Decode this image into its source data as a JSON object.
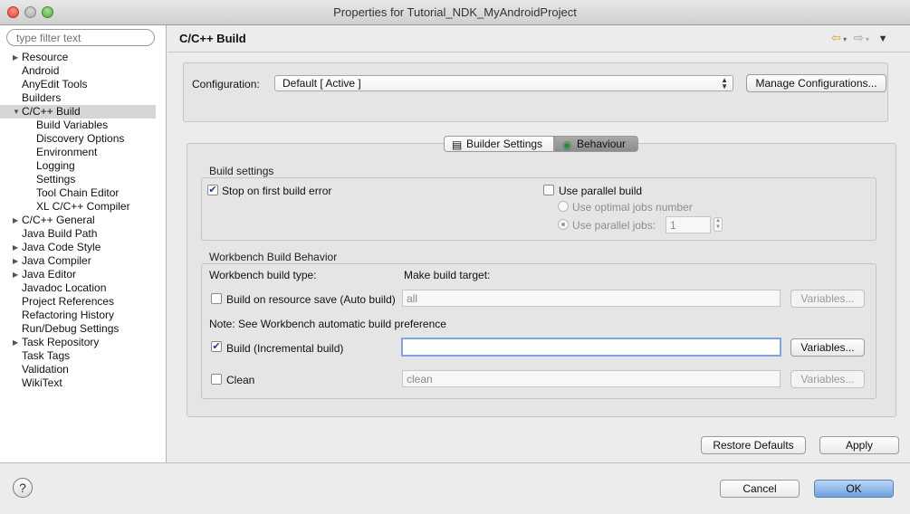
{
  "window": {
    "title": "Properties for Tutorial_NDK_MyAndroidProject"
  },
  "sidebar": {
    "filter_placeholder": "type filter text",
    "items": [
      {
        "label": "Resource",
        "expander": "right"
      },
      {
        "label": "Android"
      },
      {
        "label": "AnyEdit Tools"
      },
      {
        "label": "Builders"
      },
      {
        "label": "C/C++ Build",
        "expander": "down",
        "selected": true
      },
      {
        "label": "Build Variables",
        "child": true
      },
      {
        "label": "Discovery Options",
        "child": true
      },
      {
        "label": "Environment",
        "child": true
      },
      {
        "label": "Logging",
        "child": true
      },
      {
        "label": "Settings",
        "child": true
      },
      {
        "label": "Tool Chain Editor",
        "child": true
      },
      {
        "label": "XL C/C++ Compiler",
        "child": true
      },
      {
        "label": "C/C++ General",
        "expander": "right"
      },
      {
        "label": "Java Build Path"
      },
      {
        "label": "Java Code Style",
        "expander": "right"
      },
      {
        "label": "Java Compiler",
        "expander": "right"
      },
      {
        "label": "Java Editor",
        "expander": "right"
      },
      {
        "label": "Javadoc Location"
      },
      {
        "label": "Project References"
      },
      {
        "label": "Refactoring History"
      },
      {
        "label": "Run/Debug Settings"
      },
      {
        "label": "Task Repository",
        "expander": "right"
      },
      {
        "label": "Task Tags"
      },
      {
        "label": "Validation"
      },
      {
        "label": "WikiText"
      }
    ]
  },
  "page": {
    "title": "C/C++ Build"
  },
  "configuration": {
    "label": "Configuration:",
    "value": "Default  [ Active ]",
    "manage_button": "Manage Configurations..."
  },
  "tabs": [
    {
      "label": "Builder Settings"
    },
    {
      "label": "Behaviour",
      "active": true
    }
  ],
  "build_settings": {
    "title": "Build settings",
    "stop_on_error": "Stop on first build error",
    "stop_on_error_checked": true,
    "parallel_build": "Use parallel build",
    "parallel_build_checked": false,
    "optimal_jobs": "Use optimal jobs number",
    "parallel_jobs": "Use parallel jobs:",
    "parallel_jobs_value": "1"
  },
  "workbench": {
    "title": "Workbench Build Behavior",
    "build_type_header": "Workbench build type:",
    "target_header": "Make build target:",
    "auto_build": {
      "label": "Build on resource save (Auto build)",
      "checked": false,
      "target": "all"
    },
    "note": "Note: See Workbench automatic build preference",
    "incremental": {
      "label": "Build (Incremental build)",
      "checked": true,
      "target": ""
    },
    "clean": {
      "label": "Clean",
      "checked": false,
      "target": "clean"
    },
    "variables_button": "Variables..."
  },
  "footer": {
    "restore_defaults": "Restore Defaults",
    "apply": "Apply",
    "cancel": "Cancel",
    "ok": "OK",
    "help_glyph": "?"
  }
}
